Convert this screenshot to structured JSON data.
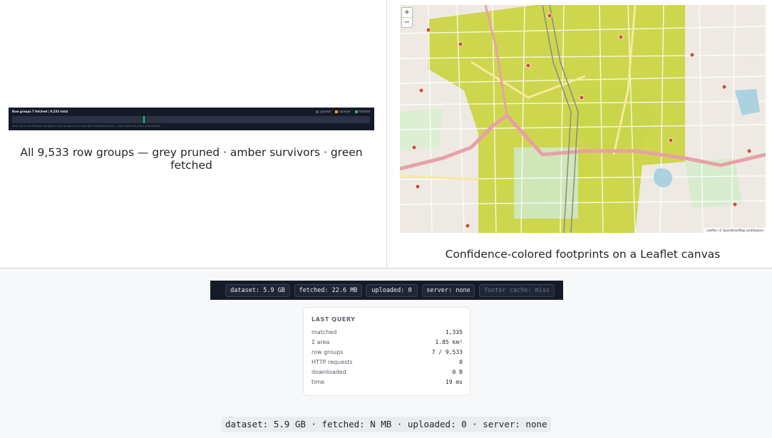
{
  "row_groups": {
    "title": "Row groups 7 fetched | 9,533 total",
    "legend": [
      {
        "label": "pruned",
        "color": "#4b5563"
      },
      {
        "label": "survivor",
        "color": "#f59e0b"
      },
      {
        "label": "fetched",
        "color": "#22c55e"
      }
    ],
    "note": "Each cell is one Parquet row group. Grey groups are pruned from metadata alone — their bytes are never downloaded.",
    "fetched_positions": [
      0.367,
      0.369
    ],
    "caption": "All 9,533 row groups — grey pruned · amber survivors · green fetched"
  },
  "map": {
    "zoom_in": "+",
    "zoom_out": "−",
    "attribution": "Leaflet | © OpenStreetMap contributors",
    "caption": "Confidence-colored footprints on a Leaflet canvas",
    "colors": {
      "footprint": "#c8d232",
      "park": "#cfe8c5",
      "water": "#aad3df",
      "road_major": "#e8a0a8",
      "road_minor": "#ffffff",
      "land": "#eeeae3"
    }
  },
  "status": {
    "dataset": "dataset: 5.9 GB",
    "fetched": "fetched: 22.6 MB",
    "uploaded": "uploaded: 0",
    "server": "server: none",
    "footer_cache": "footer cache: miss"
  },
  "last_query": {
    "title": "LAST QUERY",
    "rows": [
      {
        "key": "matched",
        "value": "1,335"
      },
      {
        "key": "Σ area",
        "value": "1.85 km²"
      },
      {
        "key": "row groups",
        "value": "7 / 9,533"
      },
      {
        "key": "HTTP requests",
        "value": "0"
      },
      {
        "key": "downloaded",
        "value": "0 B"
      },
      {
        "key": "time",
        "value": "19 ms"
      }
    ]
  },
  "summary": "dataset: 5.9 GB · fetched: N MB · uploaded: 0 · server: none"
}
